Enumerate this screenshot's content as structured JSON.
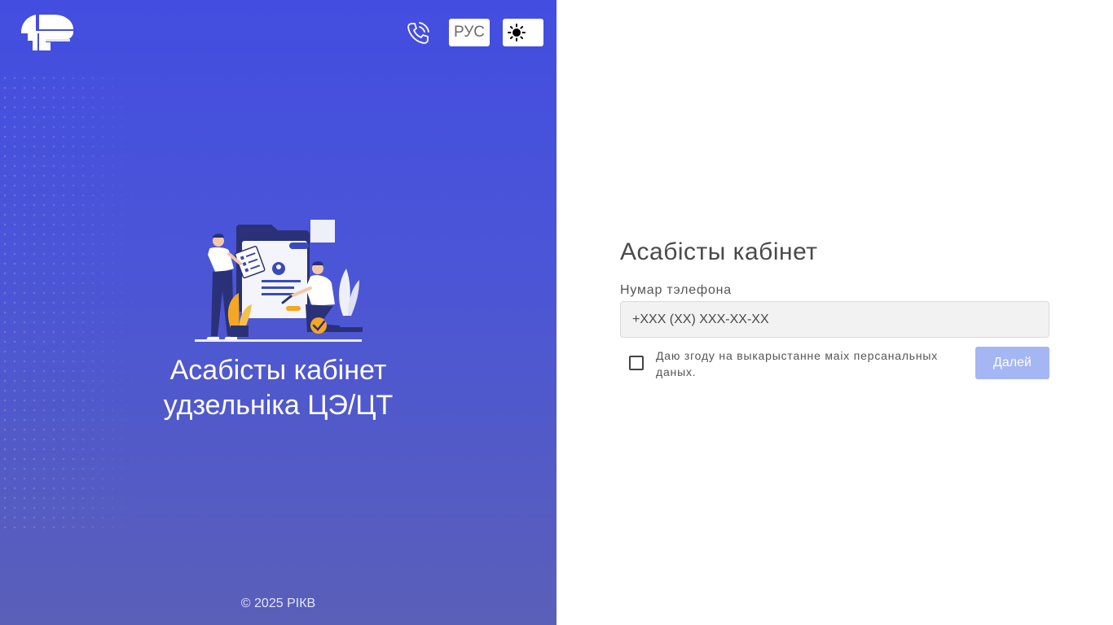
{
  "header": {
    "logo_icon": "rikv-logo-icon",
    "phone_icon": "phone-call-icon",
    "language_label": "РУС",
    "theme_icon": "sun-icon"
  },
  "hero": {
    "illustration": "documents-illustration",
    "title_line1": "Асабісты кабінет",
    "title_line2": "удзельніка ЦЭ/ЦТ"
  },
  "footer": {
    "copyright": "© 2025 РІКВ"
  },
  "form": {
    "title": "Асабісты кабінет",
    "phone_label": "Нумар тэлефона",
    "phone_placeholder": "+XXX (XX) XXX-XX-XX",
    "phone_value": "",
    "consent_text": "Даю згоду на выкарыстанне маіх персанальных даных.",
    "consent_checked": false,
    "next_label": "Далей",
    "next_enabled": false
  },
  "colors": {
    "left_gradient_top": "#434de0",
    "left_gradient_bottom": "#5a5fb8",
    "button_disabled": "#a4b6f4"
  }
}
